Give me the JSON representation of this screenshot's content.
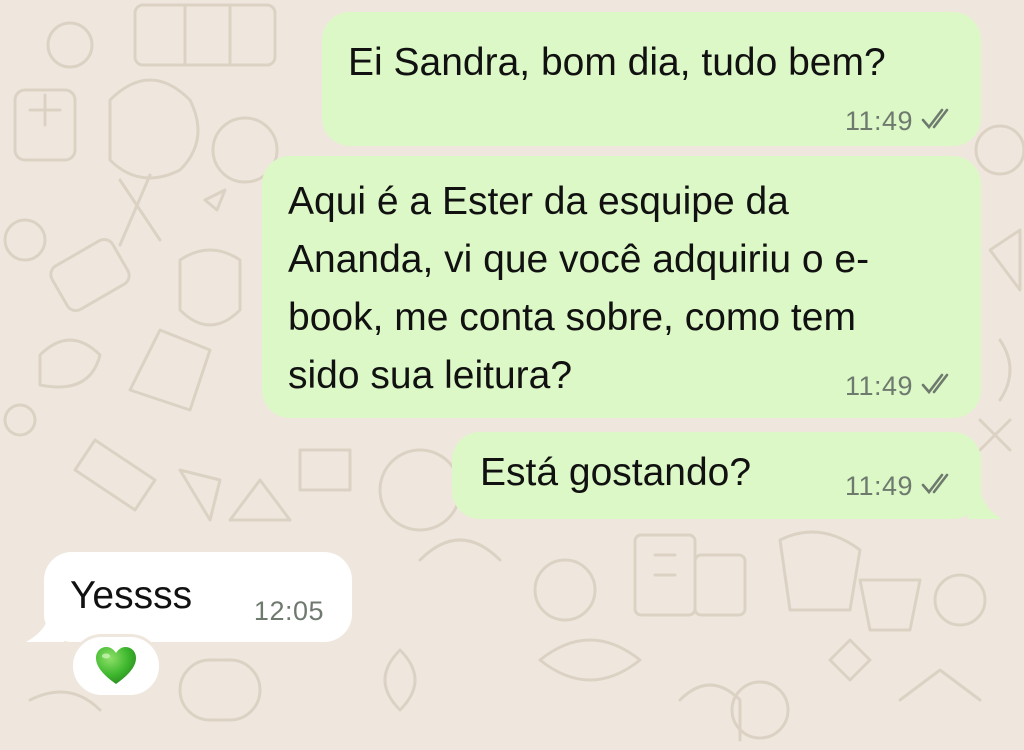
{
  "colors": {
    "wallpaper": "#efe7dd",
    "outgoing_bubble": "#dcf8c6",
    "incoming_bubble": "#ffffff",
    "timestamp": "#6f7a6f",
    "read_receipt": "#6f7a6f"
  },
  "messages": [
    {
      "direction": "outgoing",
      "text": "Ei Sandra, bom dia, tudo bem?",
      "time": "11:49",
      "status_icon": "double-check-icon"
    },
    {
      "direction": "outgoing",
      "text": "Aqui é a Ester da esquipe da\nAnanda, vi que você adquiriu o e-\nbook, me conta sobre, como tem\nsido sua leitura?",
      "time": "11:49",
      "status_icon": "double-check-icon"
    },
    {
      "direction": "outgoing",
      "text": "Está gostando?",
      "time": "11:49",
      "status_icon": "double-check-icon"
    },
    {
      "direction": "incoming",
      "text": "Yessss",
      "time": "12:05"
    }
  ],
  "reaction": {
    "emoji": "💚",
    "icon": "green-heart-icon"
  }
}
